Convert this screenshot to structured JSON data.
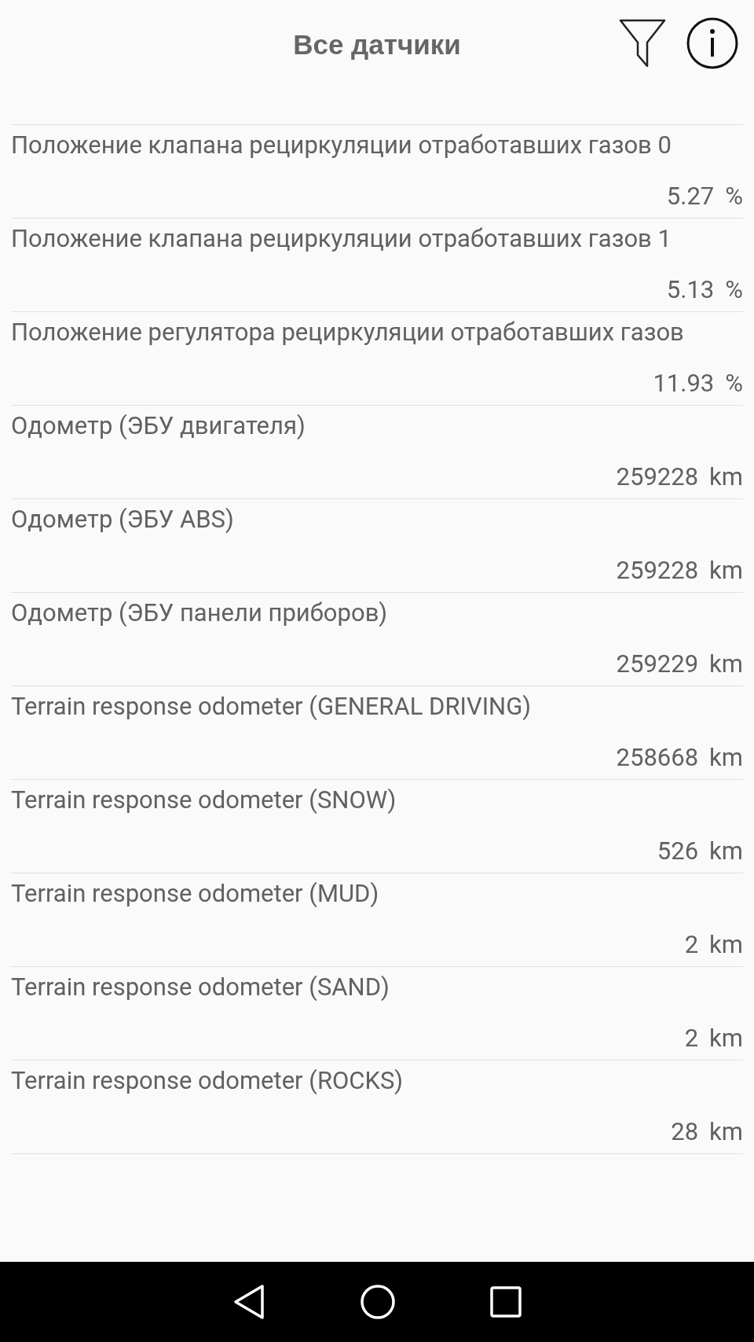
{
  "header": {
    "title": "Все датчики"
  },
  "sensors": [
    {
      "name": "Положение клапана рециркуляции отработавших газов 0",
      "value": "5.27",
      "unit": "%"
    },
    {
      "name": "Положение клапана рециркуляции отработавших газов 1",
      "value": "5.13",
      "unit": "%"
    },
    {
      "name": "Положение регулятора рециркуляции отработавших газов",
      "value": "11.93",
      "unit": "%"
    },
    {
      "name": "Одометр (ЭБУ двигателя)",
      "value": "259228",
      "unit": "km"
    },
    {
      "name": "Одометр (ЭБУ ABS)",
      "value": "259228",
      "unit": "km"
    },
    {
      "name": "Одометр (ЭБУ панели приборов)",
      "value": "259229",
      "unit": "km"
    },
    {
      "name": "Terrain response odometer (GENERAL DRIVING)",
      "value": "258668",
      "unit": "km"
    },
    {
      "name": "Terrain response odometer (SNOW)",
      "value": "526",
      "unit": "km"
    },
    {
      "name": "Terrain response odometer (MUD)",
      "value": "2",
      "unit": "km"
    },
    {
      "name": "Terrain response odometer (SAND)",
      "value": "2",
      "unit": "km"
    },
    {
      "name": "Terrain response odometer (ROCKS)",
      "value": "28",
      "unit": "km"
    }
  ]
}
